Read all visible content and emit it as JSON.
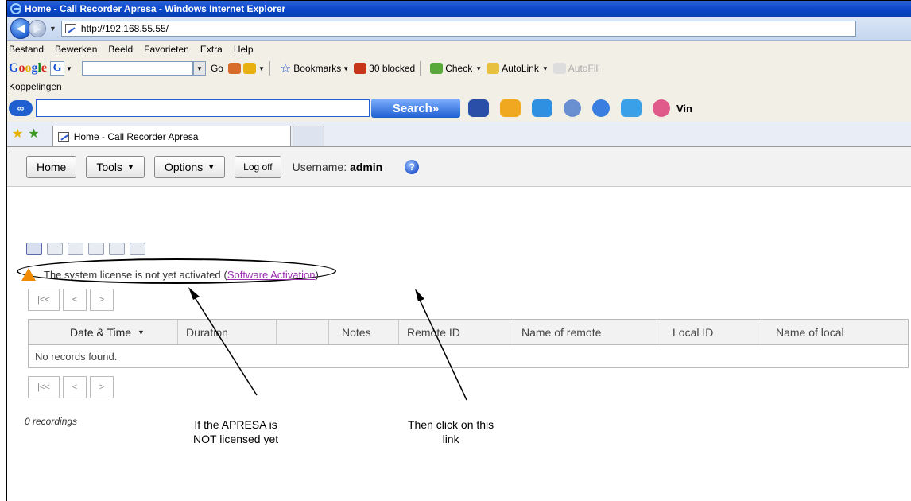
{
  "window": {
    "title": "Home - Call Recorder Apresa - Windows Internet Explorer"
  },
  "address": {
    "url": "http://192.168.55.55/"
  },
  "menu": [
    "Bestand",
    "Bewerken",
    "Beeld",
    "Favorieten",
    "Extra",
    "Help"
  ],
  "google_toolbar": {
    "logo": "Google",
    "selector": "G",
    "go": "Go",
    "bookmarks": "Bookmarks",
    "blocked": "30 blocked",
    "check": "Check",
    "autolink": "AutoLink",
    "autofill": "AutoFill"
  },
  "links_bar": {
    "label": "Koppelingen"
  },
  "search_toolbar": {
    "search_button": "Search»",
    "truncated": "Vin"
  },
  "tab": {
    "label": "Home - Call Recorder Apresa"
  },
  "app_toolbar": {
    "home": "Home",
    "tools": "Tools",
    "options": "Options",
    "logoff": "Log off",
    "username_label": "Username:",
    "username_value": "admin"
  },
  "license": {
    "message": "The system license is not yet activated",
    "paren_open": "(",
    "link": "Software Activation",
    "paren_close": ")"
  },
  "pager": {
    "first": "|<<",
    "prev": "<",
    "next": ">"
  },
  "table": {
    "columns": [
      "Date & Time",
      "Duration",
      "",
      "Notes",
      "Remote ID",
      "Name of remote",
      "Local ID",
      "Name of local"
    ],
    "empty_message": "No records found."
  },
  "recordings": {
    "count_text": "0 recordings"
  },
  "annotations": {
    "left_line1": "If the APRESA is",
    "left_line2": "NOT licensed yet",
    "right_line1": "Then click on this",
    "right_line2": "link"
  },
  "colors": {
    "titlebar": "#0a46c8",
    "link_visited": "#9b2fb0",
    "warning": "#f08a00"
  }
}
